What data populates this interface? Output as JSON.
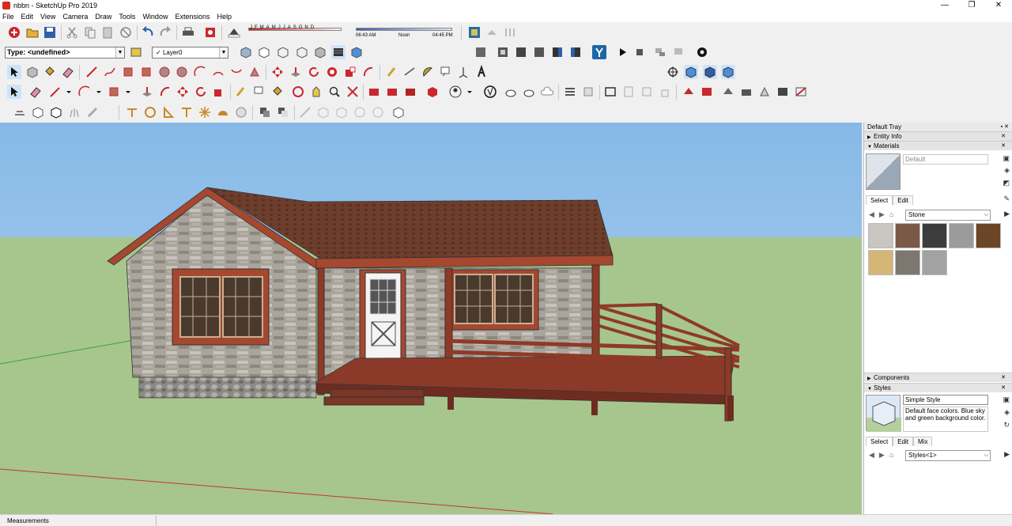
{
  "window": {
    "title": "nbbn - SketchUp Pro 2019",
    "controls": [
      "—",
      "❐",
      "✕"
    ]
  },
  "menu": [
    "File",
    "Edit",
    "View",
    "Camera",
    "Draw",
    "Tools",
    "Window",
    "Extensions",
    "Help"
  ],
  "toolbar": {
    "type_label": "Type: <undefined>",
    "layer_check": "✓",
    "layer_value": "Layer0",
    "months": [
      "J",
      "F",
      "M",
      "A",
      "M",
      "J",
      "J",
      "A",
      "S",
      "O",
      "N",
      "D"
    ],
    "time_start": "06:43 AM",
    "time_noon": "Noon",
    "time_end": "04:45 PM"
  },
  "tray": {
    "title": "Default Tray",
    "entity_info": "Entity Info",
    "materials": "Materials",
    "material_name": "Default",
    "mat_tabs": [
      "Select",
      "Edit"
    ],
    "mat_library": "Stone",
    "swatch_colors": [
      "#c9c5c0",
      "#7a5a46",
      "#3c3c3c",
      "#9b9b9b",
      "#6b4526",
      "#d4b676",
      "#7d7770",
      "#a2a2a2"
    ],
    "components": "Components",
    "styles": "Styles",
    "style_name": "Simple Style",
    "style_desc": "Default face colors. Blue sky and green background color.",
    "style_tabs": [
      "Select",
      "Edit",
      "Mix"
    ],
    "style_library": "Styles<1>"
  },
  "status": {
    "measurements": "Measurements"
  },
  "colors": {
    "sky": "#97c3ea",
    "ground": "#a7c68d",
    "roof": "#6a3c2c",
    "trim": "#a5482f",
    "deck": "#7b3626"
  }
}
